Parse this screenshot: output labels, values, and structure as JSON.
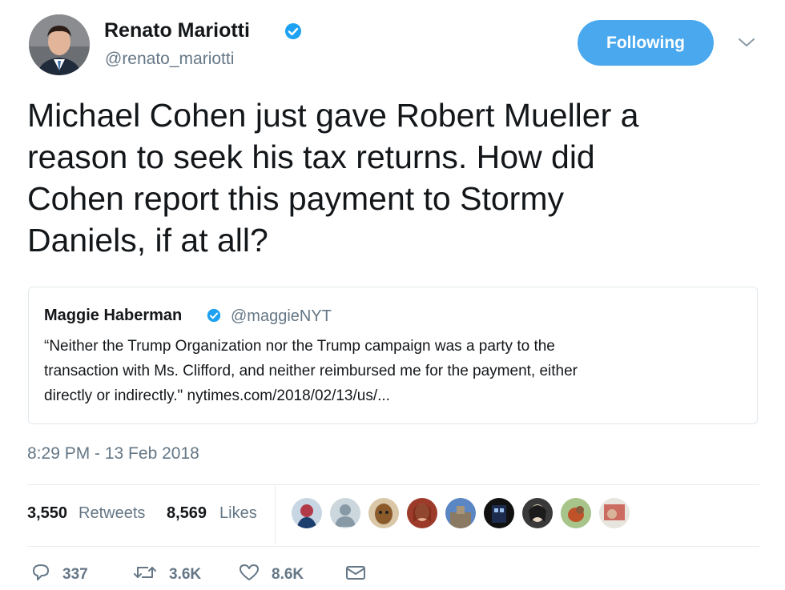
{
  "tweet": {
    "author_name": "Renato Mariotti",
    "author_handle": "@renato_mariotti",
    "follow_label": "Following",
    "text": "Michael Cohen just gave Robert Mueller a\nreason to seek his tax returns. How did\nCohen report this payment to Stormy\nDaniels, if at all?",
    "timestamp": "8:29 PM - 13 Feb 2018"
  },
  "quote": {
    "author_name": "Maggie Haberman",
    "author_handle": "@maggieNYT",
    "text": "“Neither the Trump Organization nor the Trump campaign was a party to the\ntransaction with Ms. Clifford, and neither reimbursed me for the payment, either\ndirectly or indirectly.\" nytimes.com/2018/02/13/us/..."
  },
  "stats": {
    "retweets_count": "3,550",
    "retweets_label": "Retweets",
    "likes_count": "8,569",
    "likes_label": "Likes"
  },
  "actions": {
    "reply_count": "337",
    "retweet_count": "3.6K",
    "like_count": "8.6K"
  },
  "icons": {
    "verified": "verified-badge-icon",
    "caret": "chevron-down-icon",
    "reply": "reply-icon",
    "retweet": "retweet-icon",
    "like": "heart-icon",
    "dm": "envelope-icon"
  },
  "colors": {
    "accent": "#4aa8ee",
    "secondary_text": "#657786",
    "border": "#e1e8ed"
  }
}
